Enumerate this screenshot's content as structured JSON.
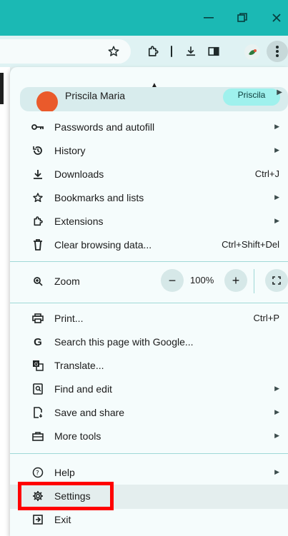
{
  "window": {
    "minimize_icon": "minimize-icon",
    "restore_icon": "restore-icon",
    "close_icon": "close-icon"
  },
  "toolbar": {
    "icons": [
      "star-icon",
      "extensions-icon",
      "download-icon",
      "side-panel-icon",
      "profile-icon",
      "kebab-menu-icon"
    ]
  },
  "menu": {
    "profile": {
      "name": "Priscila Maria",
      "chip": "Priscila"
    },
    "group1": [
      {
        "icon": "key-icon",
        "label": "Passwords and autofill",
        "chevron": true
      },
      {
        "icon": "history-icon",
        "label": "History",
        "chevron": true
      },
      {
        "icon": "download-icon",
        "label": "Downloads",
        "shortcut": "Ctrl+J"
      },
      {
        "icon": "star-icon",
        "label": "Bookmarks and lists",
        "chevron": true
      },
      {
        "icon": "puzzle-icon",
        "label": "Extensions",
        "chevron": true
      },
      {
        "icon": "trash-icon",
        "label": "Clear browsing data...",
        "shortcut": "Ctrl+Shift+Del"
      }
    ],
    "zoom": {
      "label": "Zoom",
      "value": "100%",
      "minus": "−",
      "plus": "+"
    },
    "group2": [
      {
        "icon": "print-icon",
        "label": "Print...",
        "shortcut": "Ctrl+P"
      },
      {
        "icon": "google-icon",
        "label": "Search this page with Google..."
      },
      {
        "icon": "translate-icon",
        "label": "Translate..."
      },
      {
        "icon": "find-icon",
        "label": "Find and edit",
        "chevron": true
      },
      {
        "icon": "share-icon",
        "label": "Save and share",
        "chevron": true
      },
      {
        "icon": "toolbox-icon",
        "label": "More tools",
        "chevron": true
      }
    ],
    "group3": [
      {
        "icon": "help-icon",
        "label": "Help",
        "chevron": true
      },
      {
        "icon": "gear-icon",
        "label": "Settings"
      },
      {
        "icon": "exit-icon",
        "label": "Exit"
      }
    ]
  },
  "colors": {
    "title_bar": "#1bb9b4",
    "highlight": "#ff0000",
    "menu_bg": "#f5fcfc",
    "avatar": "#ea5a2b",
    "chip": "#9ff1ed"
  }
}
